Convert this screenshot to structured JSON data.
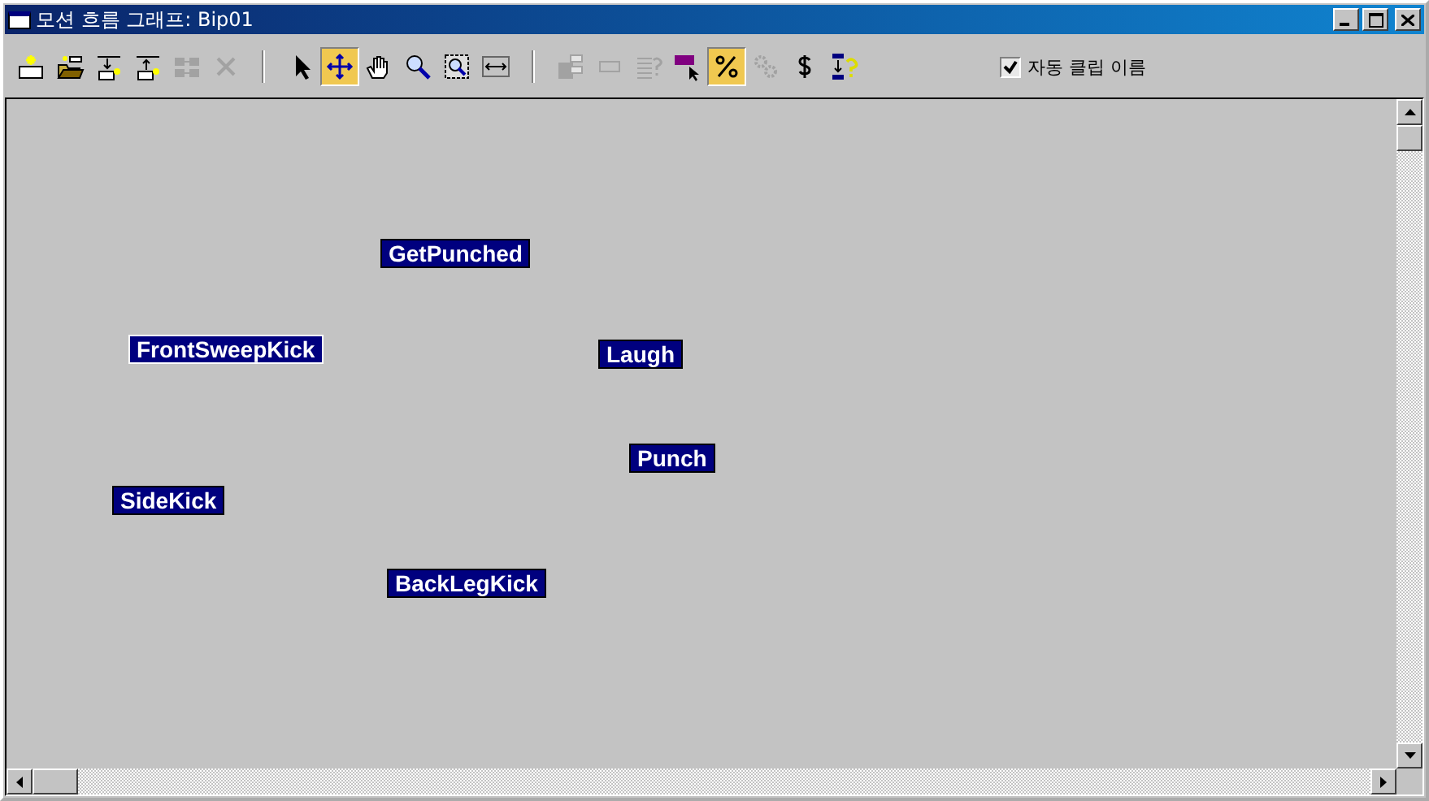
{
  "window": {
    "title": "모션 흐름 그래프: Bip01"
  },
  "toolbar": {
    "groups": [
      [
        {
          "disabled": false,
          "selected": false
        },
        {
          "disabled": false,
          "selected": false
        },
        {
          "disabled": false,
          "selected": false
        },
        {
          "disabled": false,
          "selected": false
        },
        {
          "disabled": true,
          "selected": false
        },
        {
          "disabled": true,
          "selected": false
        }
      ],
      [
        {
          "disabled": false,
          "selected": false
        },
        {
          "disabled": false,
          "selected": true
        },
        {
          "disabled": false,
          "selected": false
        },
        {
          "disabled": false,
          "selected": false
        },
        {
          "disabled": false,
          "selected": false
        },
        {
          "disabled": false,
          "selected": false
        }
      ],
      [
        {
          "disabled": true,
          "selected": false
        },
        {
          "disabled": true,
          "selected": false
        },
        {
          "disabled": true,
          "selected": false
        },
        {
          "disabled": false,
          "selected": false
        },
        {
          "disabled": false,
          "selected": true
        },
        {
          "disabled": true,
          "selected": false
        },
        {
          "disabled": false,
          "selected": false
        },
        {
          "disabled": false,
          "selected": false
        }
      ]
    ]
  },
  "auto_clip_names": {
    "label": "자동 클립 이름",
    "checked": true
  },
  "nodes": [
    {
      "label": "GetPunched",
      "selected": false
    },
    {
      "label": "FrontSweepKick",
      "selected": true
    },
    {
      "label": "Laugh",
      "selected": false
    },
    {
      "label": "Punch",
      "selected": false
    },
    {
      "label": "SideKick",
      "selected": false
    },
    {
      "label": "BackLegKick",
      "selected": false
    }
  ]
}
